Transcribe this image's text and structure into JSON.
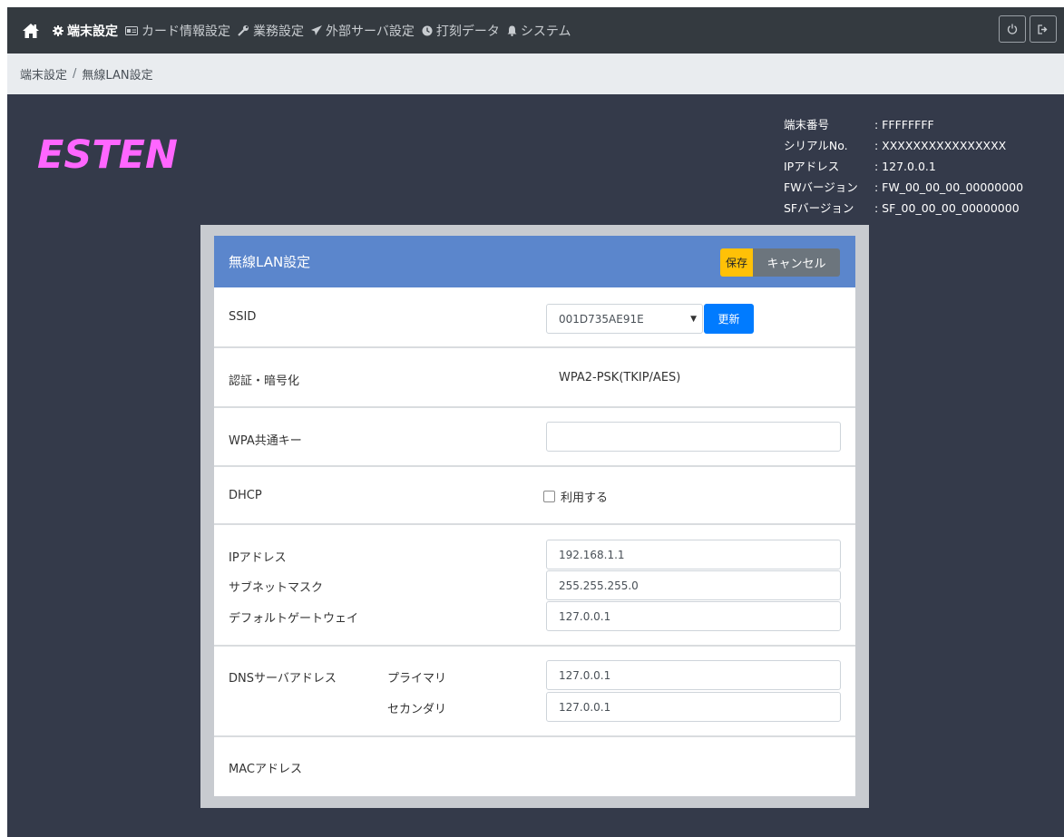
{
  "nav": {
    "items": [
      {
        "icon": "gear-icon",
        "label": "端末設定",
        "active": true
      },
      {
        "icon": "card-icon",
        "label": "カード情報設定",
        "active": false
      },
      {
        "icon": "wrench-icon",
        "label": "業務設定",
        "active": false
      },
      {
        "icon": "send-icon",
        "label": "外部サーバ設定",
        "active": false
      },
      {
        "icon": "clock-icon",
        "label": "打刻データ",
        "active": false
      },
      {
        "icon": "bell-icon",
        "label": "システム",
        "active": false
      }
    ]
  },
  "breadcrumb": {
    "parent": "端末設定",
    "separator": "/",
    "current": "無線LAN設定"
  },
  "logo": {
    "text": "ESTEN",
    "color": "#ff66ff"
  },
  "device_info": {
    "rows": [
      {
        "key": "端末番号",
        "value": ": FFFFFFFF"
      },
      {
        "key": "シリアルNo.",
        "value": ": XXXXXXXXXXXXXXXX"
      },
      {
        "key": "IPアドレス",
        "value": ": 127.0.0.1"
      },
      {
        "key": "FWバージョン",
        "value": ": FW_00_00_00_00000000"
      },
      {
        "key": "SFバージョン",
        "value": ": SF_00_00_00_00000000"
      }
    ]
  },
  "panel": {
    "title": "無線LAN設定",
    "save_label": "保存",
    "cancel_label": "キャンセル",
    "ssid": {
      "label": "SSID",
      "selected": "001D735AE91E",
      "update_label": "更新"
    },
    "auth": {
      "label": "認証・暗号化",
      "value": "WPA2-PSK(TKIP/AES)"
    },
    "wpa": {
      "label": "WPA共通キー",
      "value": ""
    },
    "dhcp": {
      "label": "DHCP",
      "checkbox_label": "利用する",
      "checked": false
    },
    "ip": {
      "ip_label": "IPアドレス",
      "ip_value": "192.168.1.1",
      "mask_label": "サブネットマスク",
      "mask_value": "255.255.255.0",
      "gw_label": "デフォルトゲートウェイ",
      "gw_value": "127.0.0.1"
    },
    "dns": {
      "label": "DNSサーバアドレス",
      "primary_label": "プライマリ",
      "primary_value": "127.0.0.1",
      "secondary_label": "セカンダリ",
      "secondary_value": "127.0.0.1"
    },
    "mac": {
      "label": "MACアドレス",
      "value": ""
    }
  },
  "colors": {
    "nav_bg": "#343a40",
    "body_bg": "#343a4a",
    "panel_header": "#5b86cc",
    "save": "#ffc107",
    "cancel": "#6c757d",
    "update": "#007bff"
  }
}
